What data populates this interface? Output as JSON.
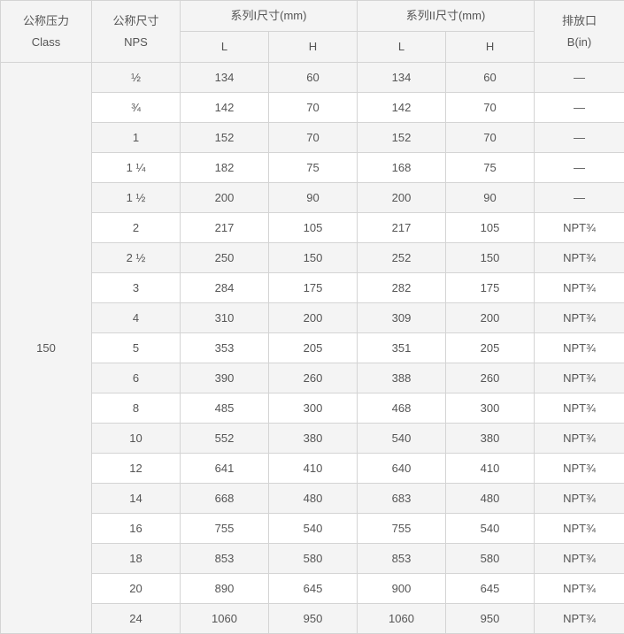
{
  "table": {
    "headers": {
      "class": {
        "zh": "公称压力",
        "en": "Class"
      },
      "nps": {
        "zh": "公称尺寸",
        "en": "NPS"
      },
      "series1": {
        "title": "系列I尺寸(mm)",
        "sub_l": "L",
        "sub_h": "H"
      },
      "series2": {
        "title": "系列II尺寸(mm)",
        "sub_l": "L",
        "sub_h": "H"
      },
      "drain": {
        "zh": "排放口",
        "en": "B(in)"
      }
    },
    "class_value": "150",
    "rows": [
      {
        "nps": "½",
        "s1_l": "134",
        "s1_h": "60",
        "s2_l": "134",
        "s2_h": "60",
        "b": "—"
      },
      {
        "nps": "¾",
        "s1_l": "142",
        "s1_h": "70",
        "s2_l": "142",
        "s2_h": "70",
        "b": "—"
      },
      {
        "nps": "1",
        "s1_l": "152",
        "s1_h": "70",
        "s2_l": "152",
        "s2_h": "70",
        "b": "—"
      },
      {
        "nps": "1 ¼",
        "s1_l": "182",
        "s1_h": "75",
        "s2_l": "168",
        "s2_h": "75",
        "b": "—"
      },
      {
        "nps": "1 ½",
        "s1_l": "200",
        "s1_h": "90",
        "s2_l": "200",
        "s2_h": "90",
        "b": "—"
      },
      {
        "nps": "2",
        "s1_l": "217",
        "s1_h": "105",
        "s2_l": "217",
        "s2_h": "105",
        "b": "NPT¾"
      },
      {
        "nps": "2 ½",
        "s1_l": "250",
        "s1_h": "150",
        "s2_l": "252",
        "s2_h": "150",
        "b": "NPT¾"
      },
      {
        "nps": "3",
        "s1_l": "284",
        "s1_h": "175",
        "s2_l": "282",
        "s2_h": "175",
        "b": "NPT¾"
      },
      {
        "nps": "4",
        "s1_l": "310",
        "s1_h": "200",
        "s2_l": "309",
        "s2_h": "200",
        "b": "NPT¾"
      },
      {
        "nps": "5",
        "s1_l": "353",
        "s1_h": "205",
        "s2_l": "351",
        "s2_h": "205",
        "b": "NPT¾"
      },
      {
        "nps": "6",
        "s1_l": "390",
        "s1_h": "260",
        "s2_l": "388",
        "s2_h": "260",
        "b": "NPT¾"
      },
      {
        "nps": "8",
        "s1_l": "485",
        "s1_h": "300",
        "s2_l": "468",
        "s2_h": "300",
        "b": "NPT¾"
      },
      {
        "nps": "10",
        "s1_l": "552",
        "s1_h": "380",
        "s2_l": "540",
        "s2_h": "380",
        "b": "NPT¾"
      },
      {
        "nps": "12",
        "s1_l": "641",
        "s1_h": "410",
        "s2_l": "640",
        "s2_h": "410",
        "b": "NPT¾"
      },
      {
        "nps": "14",
        "s1_l": "668",
        "s1_h": "480",
        "s2_l": "683",
        "s2_h": "480",
        "b": "NPT¾"
      },
      {
        "nps": "16",
        "s1_l": "755",
        "s1_h": "540",
        "s2_l": "755",
        "s2_h": "540",
        "b": "NPT¾"
      },
      {
        "nps": "18",
        "s1_l": "853",
        "s1_h": "580",
        "s2_l": "853",
        "s2_h": "580",
        "b": "NPT¾"
      },
      {
        "nps": "20",
        "s1_l": "890",
        "s1_h": "645",
        "s2_l": "900",
        "s2_h": "645",
        "b": "NPT¾"
      },
      {
        "nps": "24",
        "s1_l": "1060",
        "s1_h": "950",
        "s2_l": "1060",
        "s2_h": "950",
        "b": "NPT¾"
      }
    ]
  },
  "colors": {
    "header_bg": "#f4f4f4",
    "alt_row_bg": "#f4f4f4",
    "row_bg": "#ffffff",
    "border": "#d4d4d4",
    "text": "#555555"
  }
}
